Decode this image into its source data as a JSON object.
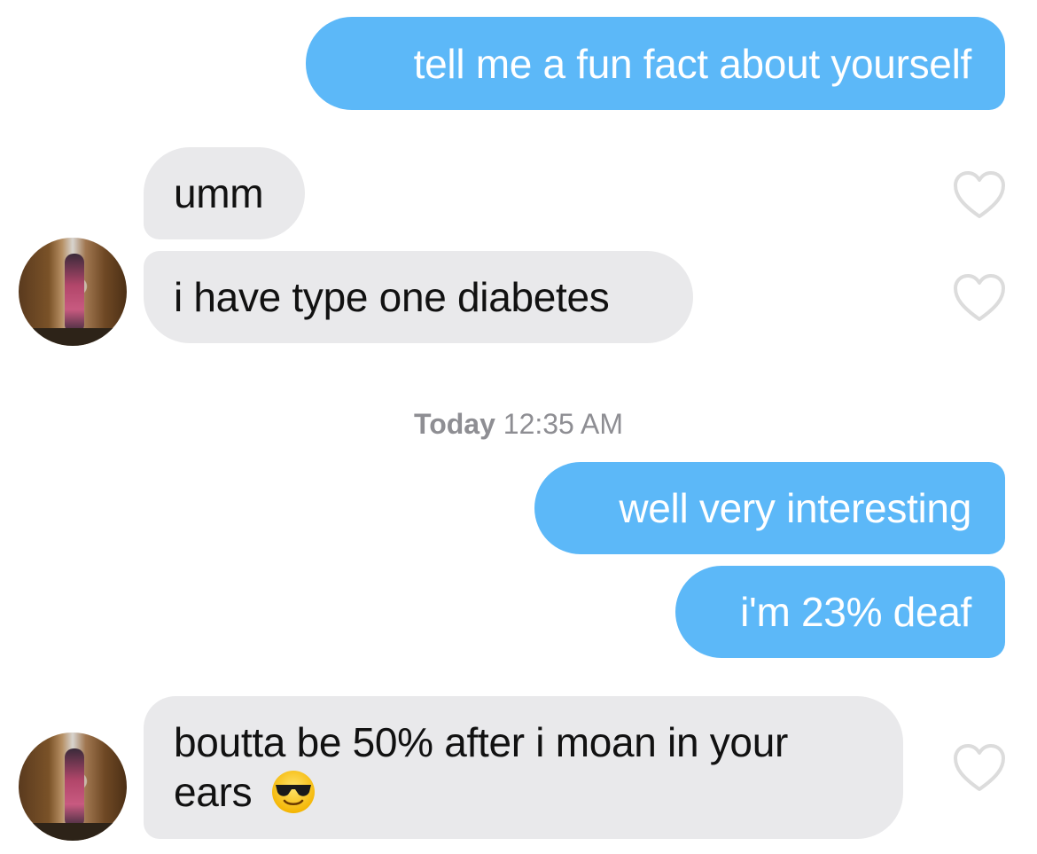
{
  "messages": [
    {
      "from": "me",
      "text": "tell me a fun fact about yourself"
    },
    {
      "from": "them",
      "text": "umm"
    },
    {
      "from": "them",
      "text": "i have type one diabetes"
    },
    {
      "from": "me",
      "text": "well very interesting"
    },
    {
      "from": "me",
      "text": "i'm 23% deaf"
    },
    {
      "from": "them",
      "text": "boutta be 50% after i moan in your ears",
      "emoji": "smiling-face-with-sunglasses-icon"
    }
  ],
  "timestamp": {
    "day": "Today",
    "time": "12:35 AM"
  },
  "colors": {
    "sent_bubble": "#5cb8f8",
    "received_bubble": "#e9e9eb",
    "timestamp": "#8e8e93",
    "heart_outline": "#dcdcdc"
  },
  "icons": {
    "like": "heart-outline-icon"
  }
}
